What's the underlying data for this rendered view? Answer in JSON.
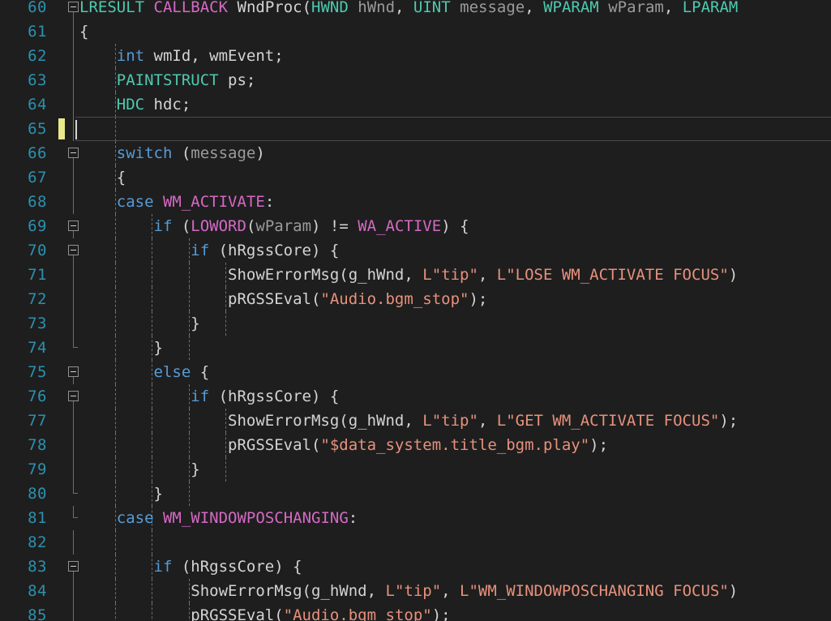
{
  "editor": {
    "language": "C++",
    "first_visible_line": 60,
    "last_visible_line": 85,
    "cursor_line": 65,
    "cursor_column": 1,
    "line_height_px": 30,
    "colors": {
      "background": "#1e1e1e",
      "foreground": "#d4d4d4",
      "line_number": "#2b91af",
      "type": "#4ec9b0",
      "keyword": "#569cd6",
      "macro": "#d569c4",
      "string": "#e8917c",
      "parameter": "#9b9b9b",
      "indent_guide": "#707070",
      "fold_marker": "#919191",
      "change_bar": "#e9e98c",
      "current_line_border": "#4a4a4a"
    },
    "gutter": {
      "change_marker_lines": [
        65
      ],
      "fold_open_lines": [
        60,
        66,
        69,
        70,
        75,
        76,
        83
      ],
      "fold_end_lines": [
        74,
        75,
        80,
        81
      ]
    },
    "lines": [
      {
        "n": 60,
        "text": "LRESULT CALLBACK WndProc(HWND hWnd, UINT message, WPARAM wParam, LPARAM"
      },
      {
        "n": 61,
        "text": "{"
      },
      {
        "n": 62,
        "text": "    int wmId, wmEvent;"
      },
      {
        "n": 63,
        "text": "    PAINTSTRUCT ps;"
      },
      {
        "n": 64,
        "text": "    HDC hdc;"
      },
      {
        "n": 65,
        "text": ""
      },
      {
        "n": 66,
        "text": "    switch (message)"
      },
      {
        "n": 67,
        "text": "    {"
      },
      {
        "n": 68,
        "text": "    case WM_ACTIVATE:"
      },
      {
        "n": 69,
        "text": "        if (LOWORD(wParam) != WA_ACTIVE) {"
      },
      {
        "n": 70,
        "text": "            if (hRgssCore) {"
      },
      {
        "n": 71,
        "text": "                ShowErrorMsg(g_hWnd, L\"tip\", L\"LOSE WM_ACTIVATE FOCUS\");"
      },
      {
        "n": 72,
        "text": "                pRGSSEval(\"Audio.bgm_stop\");"
      },
      {
        "n": 73,
        "text": "            }"
      },
      {
        "n": 74,
        "text": "        }"
      },
      {
        "n": 75,
        "text": "        else {"
      },
      {
        "n": 76,
        "text": "            if (hRgssCore) {"
      },
      {
        "n": 77,
        "text": "                ShowErrorMsg(g_hWnd, L\"tip\", L\"GET WM_ACTIVATE FOCUS\");"
      },
      {
        "n": 78,
        "text": "                pRGSSEval(\"$data_system.title_bgm.play\");"
      },
      {
        "n": 79,
        "text": "            }"
      },
      {
        "n": 80,
        "text": "        }"
      },
      {
        "n": 81,
        "text": "    case WM_WINDOWPOSCHANGING:"
      },
      {
        "n": 82,
        "text": ""
      },
      {
        "n": 83,
        "text": "        if (hRgssCore) {"
      },
      {
        "n": 84,
        "text": "            ShowErrorMsg(g_hWnd, L\"tip\", L\"WM_WINDOWPOSCHANGING FOCUS\")"
      },
      {
        "n": 85,
        "text": "            pRGSSEval(\"Audio.bgm_stop\");"
      }
    ],
    "tokens": {
      "l60": [
        {
          "t": "LRESULT",
          "c": "type"
        },
        {
          "t": " ",
          "c": "plain"
        },
        {
          "t": "CALLBACK",
          "c": "macro"
        },
        {
          "t": " ",
          "c": "plain"
        },
        {
          "t": "WndProc",
          "c": "plain"
        },
        {
          "t": "(",
          "c": "punct"
        },
        {
          "t": "HWND",
          "c": "type"
        },
        {
          "t": " ",
          "c": "plain"
        },
        {
          "t": "hWnd",
          "c": "param"
        },
        {
          "t": ", ",
          "c": "punct"
        },
        {
          "t": "UINT",
          "c": "type"
        },
        {
          "t": " ",
          "c": "plain"
        },
        {
          "t": "message",
          "c": "param"
        },
        {
          "t": ", ",
          "c": "punct"
        },
        {
          "t": "WPARAM",
          "c": "type"
        },
        {
          "t": " ",
          "c": "plain"
        },
        {
          "t": "wParam",
          "c": "param"
        },
        {
          "t": ", ",
          "c": "punct"
        },
        {
          "t": "LPARAM",
          "c": "type"
        }
      ],
      "l61": [
        {
          "t": "{",
          "c": "punct"
        }
      ],
      "l62": [
        {
          "t": "int",
          "c": "keyword"
        },
        {
          "t": " wmId, wmEvent;",
          "c": "plain"
        }
      ],
      "l63": [
        {
          "t": "PAINTSTRUCT",
          "c": "type"
        },
        {
          "t": " ps;",
          "c": "plain"
        }
      ],
      "l64": [
        {
          "t": "HDC",
          "c": "type"
        },
        {
          "t": " hdc;",
          "c": "plain"
        }
      ],
      "l66": [
        {
          "t": "switch",
          "c": "keyword"
        },
        {
          "t": " (",
          "c": "punct"
        },
        {
          "t": "message",
          "c": "param"
        },
        {
          "t": ")",
          "c": "punct"
        }
      ],
      "l67": [
        {
          "t": "{",
          "c": "punct"
        }
      ],
      "l68": [
        {
          "t": "case",
          "c": "keyword"
        },
        {
          "t": " ",
          "c": "plain"
        },
        {
          "t": "WM_ACTIVATE",
          "c": "macro"
        },
        {
          "t": ":",
          "c": "punct"
        }
      ],
      "l69": [
        {
          "t": "if",
          "c": "keyword"
        },
        {
          "t": " (",
          "c": "punct"
        },
        {
          "t": "LOWORD",
          "c": "macro"
        },
        {
          "t": "(",
          "c": "punct"
        },
        {
          "t": "wParam",
          "c": "param"
        },
        {
          "t": ") != ",
          "c": "punct"
        },
        {
          "t": "WA_ACTIVE",
          "c": "macro"
        },
        {
          "t": ") {",
          "c": "punct"
        }
      ],
      "l70": [
        {
          "t": "if",
          "c": "keyword"
        },
        {
          "t": " (hRgssCore) {",
          "c": "plain"
        }
      ],
      "l71": [
        {
          "t": "ShowErrorMsg(g_hWnd, ",
          "c": "plain"
        },
        {
          "t": "L\"tip\"",
          "c": "string"
        },
        {
          "t": ", ",
          "c": "plain"
        },
        {
          "t": "L\"LOSE WM_ACTIVATE FOCUS\"",
          "c": "string"
        },
        {
          "t": ")",
          "c": "plain"
        }
      ],
      "l72": [
        {
          "t": "pRGSSEval(",
          "c": "plain"
        },
        {
          "t": "\"Audio.bgm_stop\"",
          "c": "string"
        },
        {
          "t": ");",
          "c": "plain"
        }
      ],
      "l73": [
        {
          "t": "}",
          "c": "punct"
        }
      ],
      "l74": [
        {
          "t": "}",
          "c": "punct"
        }
      ],
      "l75": [
        {
          "t": "else",
          "c": "keyword"
        },
        {
          "t": " {",
          "c": "punct"
        }
      ],
      "l76": [
        {
          "t": "if",
          "c": "keyword"
        },
        {
          "t": " (hRgssCore) {",
          "c": "plain"
        }
      ],
      "l77": [
        {
          "t": "ShowErrorMsg(g_hWnd, ",
          "c": "plain"
        },
        {
          "t": "L\"tip\"",
          "c": "string"
        },
        {
          "t": ", ",
          "c": "plain"
        },
        {
          "t": "L\"GET WM_ACTIVATE FOCUS\"",
          "c": "string"
        },
        {
          "t": ");",
          "c": "plain"
        }
      ],
      "l78": [
        {
          "t": "pRGSSEval(",
          "c": "plain"
        },
        {
          "t": "\"$data_system.title_bgm.play\"",
          "c": "string"
        },
        {
          "t": ");",
          "c": "plain"
        }
      ],
      "l79": [
        {
          "t": "}",
          "c": "punct"
        }
      ],
      "l80": [
        {
          "t": "}",
          "c": "punct"
        }
      ],
      "l81": [
        {
          "t": "case",
          "c": "keyword"
        },
        {
          "t": " ",
          "c": "plain"
        },
        {
          "t": "WM_WINDOWPOSCHANGING",
          "c": "macro"
        },
        {
          "t": ":",
          "c": "punct"
        }
      ],
      "l83": [
        {
          "t": "if",
          "c": "keyword"
        },
        {
          "t": " (hRgssCore) {",
          "c": "plain"
        }
      ],
      "l84": [
        {
          "t": "ShowErrorMsg(g_hWnd, ",
          "c": "plain"
        },
        {
          "t": "L\"tip\"",
          "c": "string"
        },
        {
          "t": ", ",
          "c": "plain"
        },
        {
          "t": "L\"WM_WINDOWPOSCHANGING FOCUS\"",
          "c": "string"
        },
        {
          "t": ")",
          "c": "plain"
        }
      ],
      "l85": [
        {
          "t": "pRGSSEval(",
          "c": "plain"
        },
        {
          "t": "\"Audio.bgm_stop\"",
          "c": "string"
        },
        {
          "t": ");",
          "c": "plain"
        }
      ]
    }
  }
}
